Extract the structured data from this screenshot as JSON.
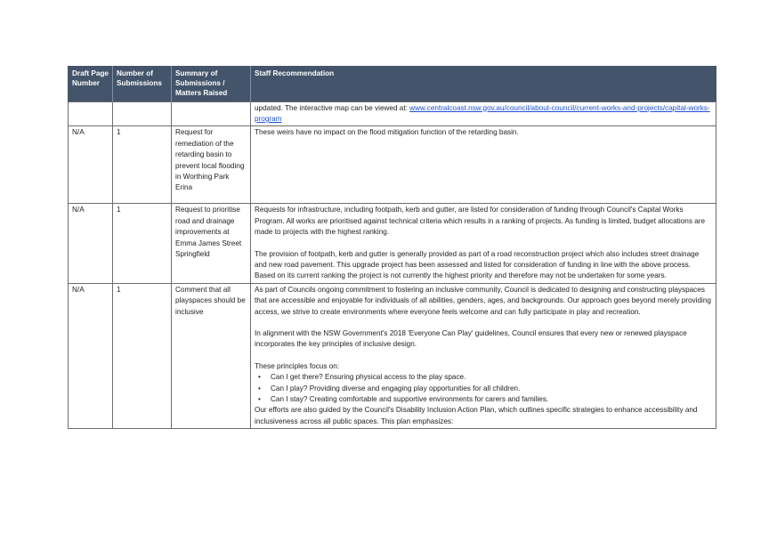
{
  "table": {
    "headers": [
      "Draft Page Number",
      "Number of Submissions",
      "Summary of Submissions / Matters Raised",
      "Staff Recommendation"
    ],
    "row0": {
      "page": "",
      "count": "",
      "summary": "",
      "text_prefix": "updated. The interactive map can be viewed at: ",
      "link": "www.centralcoast.nsw.gov.au/council/about-council/current-works-and-projects/capital-works-program"
    },
    "row1": {
      "page": "N/A",
      "count": "1",
      "summary": "Request for remediation of the retarding basin to prevent local flooding in Worthing Park Erina",
      "rec": "These weirs have no impact on the flood mitigation function of the retarding basin."
    },
    "row2": {
      "page": "N/A",
      "count": "1",
      "summary": "Request to prioritise road and drainage improvements at Emma James Street Springfield",
      "rec_p1": "Requests for infrastructure, including footpath, kerb and gutter, are listed for consideration of funding through Council's Capital Works Program. All works are prioritised against technical criteria which results in a ranking of projects. As funding is limited, budget allocations are made to projects with the highest ranking.",
      "rec_p2": "The provision of footpath, kerb and gutter is generally provided as part of a road reconstruction project which also includes street drainage and new road pavement. This upgrade project has been assessed and listed for consideration of funding in line with the above process. Based on its current ranking the project is not currently the highest priority and therefore may not be undertaken for some years."
    },
    "row3": {
      "page": "N/A",
      "count": "1",
      "summary": "Comment that all playspaces should be inclusive",
      "rec_p1": "As part of Councils ongoing commitment to fostering an inclusive community, Council is dedicated to designing and constructing playspaces that are accessible and enjoyable for individuals of all abilities, genders, ages, and backgrounds. Our approach goes beyond merely providing access, we strive to create environments where everyone feels welcome and can fully participate in play and recreation.",
      "rec_p2": "In alignment with the NSW Government's 2018 'Everyone Can Play' guidelines, Council ensures that every new or renewed playspace incorporates the key principles of inclusive design.",
      "rec_p3": "These principles focus on:",
      "bullets": [
        "Can I get there? Ensuring physical access to the play space.",
        "Can I play? Providing diverse and engaging play opportunities for all children.",
        "Can I stay? Creating comfortable and supportive environments for carers and families."
      ],
      "rec_p4": "Our efforts are also guided by the Council's Disability Inclusion Action Plan, which outlines specific strategies to enhance accessibility and inclusiveness across all public spaces. This plan emphasizes:"
    }
  }
}
